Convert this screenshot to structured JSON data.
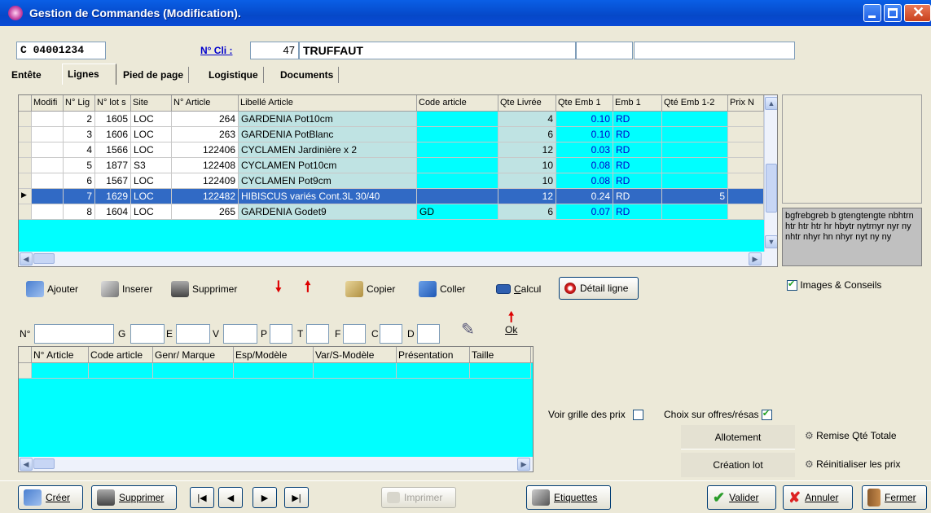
{
  "window": {
    "title": "Gestion de Commandes (Modification)."
  },
  "header": {
    "order_number": "C 04001234",
    "client_label": "N° Cli :",
    "client_number": "47",
    "client_name": "TRUFFAUT",
    "extra1": "",
    "extra2": ""
  },
  "tabs": [
    {
      "label": "Entête"
    },
    {
      "label": "Lignes"
    },
    {
      "label": "Pied de page"
    },
    {
      "label": "Logistique"
    },
    {
      "label": "Documents"
    }
  ],
  "lines_grid": {
    "columns": [
      "Modifi",
      "N° Lig",
      "N° lot s",
      "Site",
      "N° Article",
      "Libellé Article",
      "Code article",
      "Qte Livrée",
      "Qte Emb 1",
      "Emb 1",
      "Qté Emb 1-2",
      "Prix N"
    ],
    "rows": [
      {
        "ligne": "2",
        "lot": "1605",
        "site": "LOC",
        "article": "264",
        "libelle": "GARDENIA Pot10cm",
        "code": "",
        "qte": "4",
        "emb": "0.10",
        "emb1": "RD",
        "emb12": ""
      },
      {
        "ligne": "3",
        "lot": "1606",
        "site": "LOC",
        "article": "263",
        "libelle": "GARDENIA PotBlanc",
        "code": "",
        "qte": "6",
        "emb": "0.10",
        "emb1": "RD",
        "emb12": ""
      },
      {
        "ligne": "4",
        "lot": "1566",
        "site": "LOC",
        "article": "122406",
        "libelle": "CYCLAMEN Jardinière x 2",
        "code": "",
        "qte": "12",
        "emb": "0.03",
        "emb1": "RD",
        "emb12": ""
      },
      {
        "ligne": "5",
        "lot": "1877",
        "site": "S3",
        "article": "122408",
        "libelle": "CYCLAMEN Pot10cm",
        "code": "",
        "qte": "10",
        "emb": "0.08",
        "emb1": "RD",
        "emb12": ""
      },
      {
        "ligne": "6",
        "lot": "1567",
        "site": "LOC",
        "article": "122409",
        "libelle": "CYCLAMEN Pot9cm",
        "code": "",
        "qte": "10",
        "emb": "0.08",
        "emb1": "RD",
        "emb12": ""
      },
      {
        "ligne": "7",
        "lot": "1629",
        "site": "LOC",
        "article": "122482",
        "libelle": "HIBISCUS variés Cont.3L 30/40",
        "code": "",
        "qte": "12",
        "emb": "0.24",
        "emb1": "RD",
        "emb12": "5"
      },
      {
        "ligne": "8",
        "lot": "1604",
        "site": "LOC",
        "article": "265",
        "libelle": "GARDENIA Godet9",
        "code": "GD",
        "qte": "6",
        "emb": "0.07",
        "emb1": "RD",
        "emb12": ""
      }
    ],
    "selected_row": 5
  },
  "info_text": "bgfrebgreb b gtengtengte nbhtrn htr htr htr hr hbytr nytrnyr nyr ny nhtr nhyr  hn nhyr nyt ny ny",
  "images_conseils": {
    "label": "Images & Conseils",
    "checked": true
  },
  "toolbar": {
    "ajouter": "Ajouter",
    "inserer": "Inserer",
    "supprimer": "Supprimer",
    "copier": "Copier",
    "coller": "Coller",
    "calcul": "Calcul",
    "detail": "Détail ligne"
  },
  "search": {
    "n_label": "N°",
    "g": "G",
    "e": "E",
    "v": "V",
    "p": "P",
    "t": "T",
    "f": "F",
    "c": "C",
    "d": "D",
    "ok": "Ok"
  },
  "article_grid": {
    "columns": [
      "N° Article",
      "Code article",
      "Genr/ Marque",
      "Esp/Modèle",
      "Var/S-Modèle",
      "Présentation",
      "Taille"
    ]
  },
  "options": {
    "voir_grille": "Voir grille des prix",
    "voir_grille_checked": false,
    "choix_offres": "Choix sur offres/résas",
    "choix_offres_checked": true
  },
  "actions": {
    "allotement": "Allotement",
    "remise": "Remise Qté Totale",
    "creation_lot": "Création lot",
    "reinit": "Réinitialiser les prix"
  },
  "bottom": {
    "creer": "Créer",
    "supprimer": "Supprimer",
    "imprimer": "Imprimer",
    "etiquettes": "Etiquettes",
    "valider": "Valider",
    "annuler": "Annuler",
    "fermer": "Fermer"
  },
  "colors": {
    "titlebar": "#0548c8",
    "cyan": "#00ffff",
    "selection": "#316ac5",
    "face": "#ece9d8"
  }
}
